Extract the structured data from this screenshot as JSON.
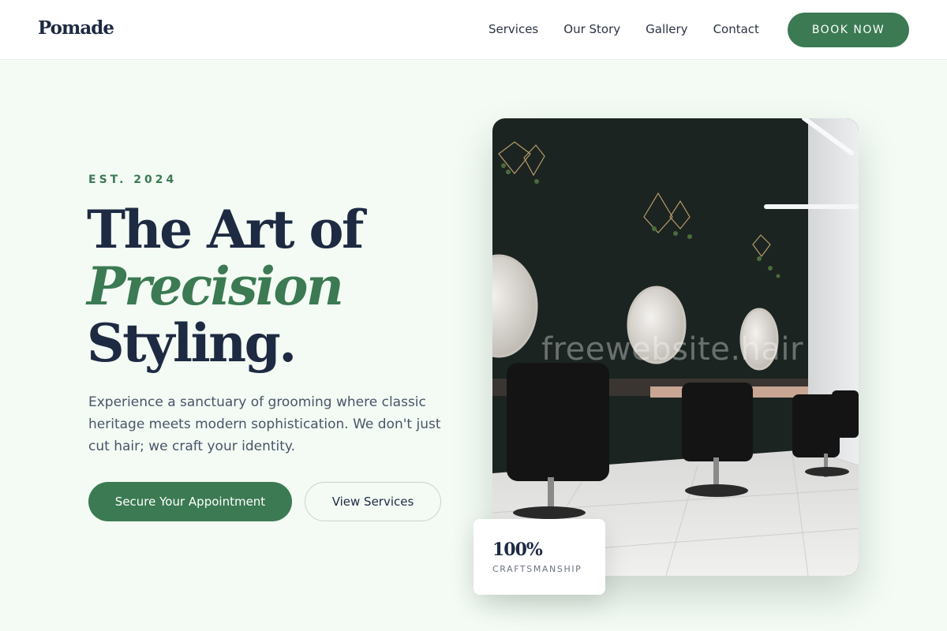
{
  "nav": {
    "logo": "Pomade",
    "links": [
      "Services",
      "Our Story",
      "Gallery",
      "Contact"
    ],
    "cta": "BOOK NOW"
  },
  "hero": {
    "eyebrow": "EST. 2024",
    "headline_line1": "The Art of",
    "headline_accent": "Precision",
    "headline_line3": "Styling.",
    "description": "Experience a sanctuary of grooming where classic heritage meets modern sophistication. We don't just cut hair; we craft your identity.",
    "primary_button": "Secure Your Appointment",
    "secondary_button": "View Services",
    "image_watermark": "freewebsite.hair"
  },
  "stat": {
    "value": "100%",
    "label": "CRAFTSMANSHIP"
  },
  "colors": {
    "accent": "#3b7a52",
    "heading": "#1e2a42",
    "background": "#f3fbf4"
  }
}
